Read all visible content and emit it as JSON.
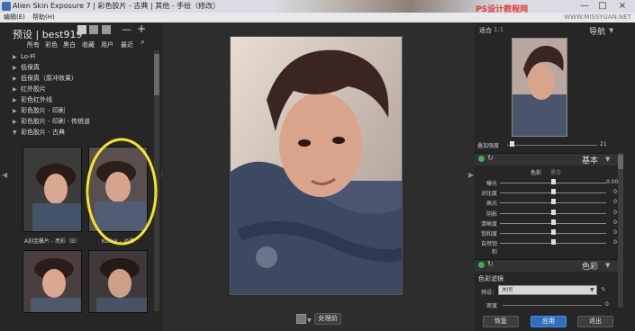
{
  "window": {
    "title": "Alien Skin Exposure 7 | 彩色胶片 - 古典 | 其他 - 手绘（修改）",
    "watermark": "PS设计教程网",
    "watermark_url": "WWW.MISSYUAN.NET",
    "controls": [
      "—",
      "□",
      "×"
    ]
  },
  "menu": {
    "items": [
      "编辑(E)",
      "帮助(H)"
    ]
  },
  "left_panel": {
    "preset_label": "预设 | best919",
    "tabs": [
      "所有",
      "彩色",
      "黑白",
      "收藏",
      "用户",
      "最近"
    ],
    "tree": [
      {
        "label": "Lo-Fi",
        "expanded": false
      },
      {
        "label": "低保真",
        "expanded": false
      },
      {
        "label": "低保真（原冲效果）",
        "expanded": false
      },
      {
        "label": "红外胶片",
        "expanded": false
      },
      {
        "label": "彩色红外线",
        "expanded": false
      },
      {
        "label": "彩色胶片 - 印刷",
        "expanded": false
      },
      {
        "label": "彩色胶片 - 印刷 - 传统道",
        "expanded": false
      },
      {
        "label": "彩色胶片 - 古典",
        "expanded": true
      }
    ],
    "thumbnails": [
      {
        "label": "A刻金雕片 - 亮彩（B）"
      },
      {
        "label": "Kodak - 淡黄"
      },
      {
        "label": ""
      },
      {
        "label": ""
      }
    ]
  },
  "center": {
    "process_button": "处理前"
  },
  "right_panel": {
    "zoom_fit": "适合",
    "zoom_ratio": "1:1",
    "navigator_label": "导航",
    "overlay_label": "叠加强度",
    "overlay_value": "21",
    "basic_label": "基本",
    "mode_tabs": [
      "色彩",
      "黑白"
    ],
    "sliders": [
      {
        "label": "曝光",
        "value": "0.00",
        "level": 0.5
      },
      {
        "label": "对比度",
        "value": "0",
        "level": 0.5
      },
      {
        "label": "高光",
        "value": "0",
        "level": 0.5
      },
      {
        "label": "阴影",
        "value": "0",
        "level": 0.5
      },
      {
        "label": "清晰度",
        "value": "0",
        "level": 0.5
      },
      {
        "label": "饱和度",
        "value": "0",
        "level": 0.5
      },
      {
        "label": "自然饱和",
        "value": "0",
        "level": 0.5
      }
    ],
    "color_label": "色彩",
    "color_filter_label": "色彩滤镜",
    "preset_field_label": "预设：",
    "preset_field_value": "关闭",
    "density_label": "密度",
    "density_value": "0",
    "buttons": {
      "reset": "恢复",
      "apply": "应用",
      "exit": "退出"
    }
  }
}
